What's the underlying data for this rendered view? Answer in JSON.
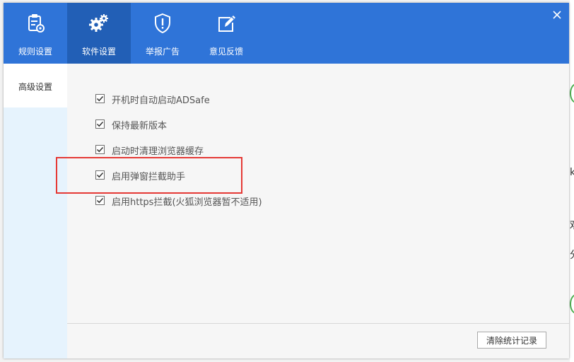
{
  "background_app": {
    "edge_glyphs": [
      "亅",
      "k",
      "欢",
      "分"
    ]
  },
  "tabs": [
    {
      "label": "规则设置",
      "icon": "clipboard-gear-icon",
      "active": false
    },
    {
      "label": "软件设置",
      "icon": "gears-icon",
      "active": true
    },
    {
      "label": "举报广告",
      "icon": "shield-alert-icon",
      "active": false
    },
    {
      "label": "意见反馈",
      "icon": "edit-feedback-icon",
      "active": false
    }
  ],
  "sidebar": {
    "items": [
      {
        "label": "高级设置",
        "selected": true
      }
    ]
  },
  "options": [
    {
      "label": "开机时自动启动ADSafe",
      "checked": true
    },
    {
      "label": "保持最新版本",
      "checked": true
    },
    {
      "label": "启动时清理浏览器缓存",
      "checked": true
    },
    {
      "label": "启用弹窗拦截助手",
      "checked": true
    },
    {
      "label": "启用https拦截(火狐浏览器暂不适用)",
      "checked": true
    }
  ],
  "footer": {
    "clear_button_label": "清除统计记录"
  },
  "colors": {
    "topbar": "#2f74d8",
    "active_tab": "#225fb6",
    "sidebar": "#e6f3fd",
    "highlight": "#e53935"
  }
}
